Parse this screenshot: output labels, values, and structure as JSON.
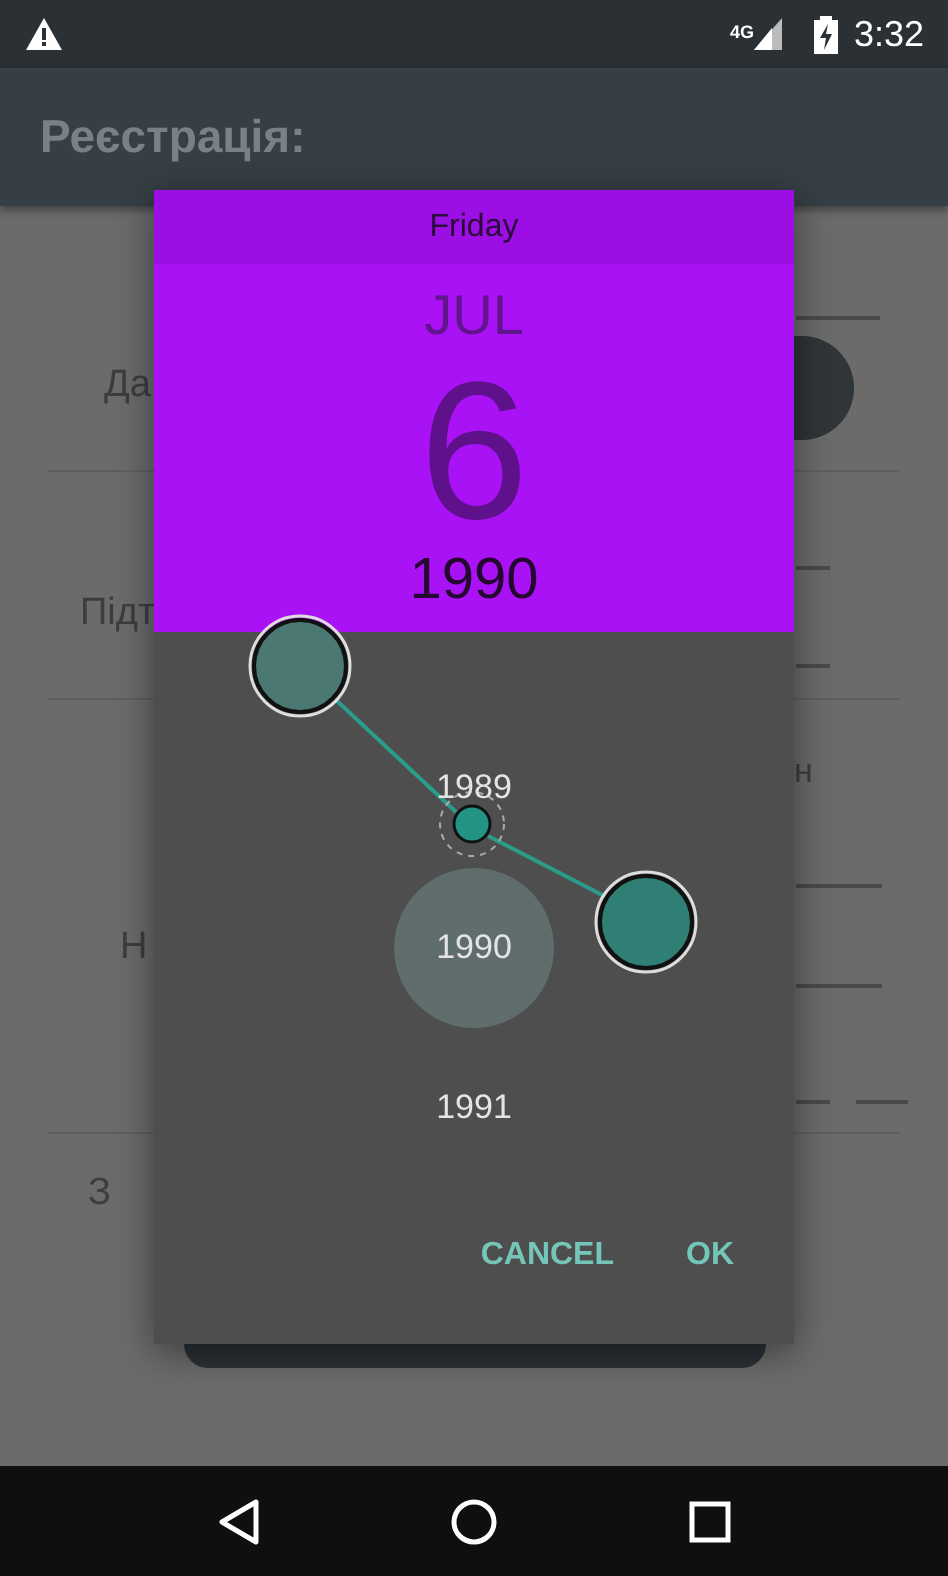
{
  "status_bar": {
    "network": "4G",
    "time": "3:32"
  },
  "app_bar": {
    "title": "Реєстрація:"
  },
  "background_labels": [
    {
      "text": "Да"
    },
    {
      "text": "Підт"
    },
    {
      "text": "Н"
    },
    {
      "text": "З"
    }
  ],
  "background_side_text": "н",
  "dialog": {
    "day_of_week": "Friday",
    "month": "JUL",
    "day": "6",
    "year": "1990",
    "years": [
      {
        "label": "1989",
        "selected": false
      },
      {
        "label": "1990",
        "selected": true
      },
      {
        "label": "1991",
        "selected": false
      }
    ],
    "buttons": [
      {
        "label": "CANCEL"
      },
      {
        "label": "OK"
      }
    ]
  }
}
